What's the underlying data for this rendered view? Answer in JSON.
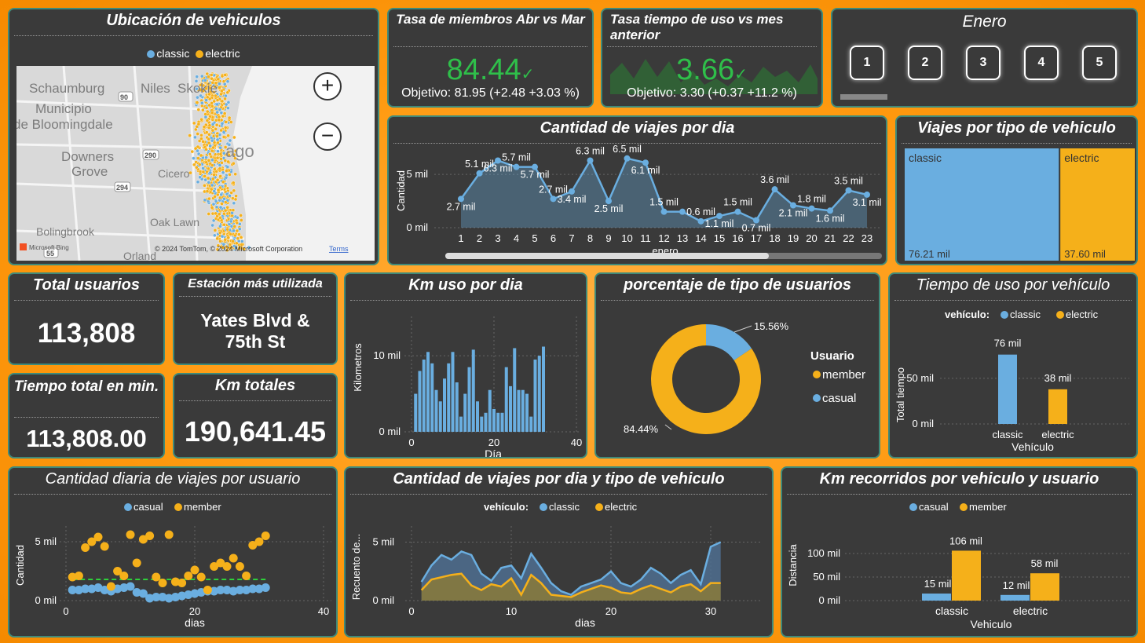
{
  "colors": {
    "classic": "#6aaee0",
    "electric": "#f5b01a",
    "casual": "#6aaee0",
    "member": "#f5b01a",
    "kpi_green": "#2fbf4a",
    "card": "#3a3a3a"
  },
  "map": {
    "title": "Ubicación de vehiculos",
    "legend": [
      "classic",
      "electric"
    ],
    "places": [
      "Schaumburg",
      "Niles",
      "Skokie",
      "Municipio",
      "de Bloomingdale",
      "Downers",
      "Grove",
      "Cicero",
      "Oak Lawn",
      "Bolingbrook",
      "Orland",
      "ago"
    ],
    "roads": [
      "90",
      "290",
      "294",
      "55"
    ],
    "attribution": "© 2024 TomTom, © 2024 Microsoft Corporation",
    "terms": "Terms",
    "bing": "Microsoft Bing",
    "zoom_in": "+",
    "zoom_out": "−"
  },
  "kpi_members": {
    "title": "Tasa de miembros Abr vs Mar",
    "value": "84.44",
    "check": "✓",
    "goal": "Objetivo: 81.95 (+2.48 +3.03 %)"
  },
  "kpi_time": {
    "title": "Tasa tiempo de uso vs mes anterior",
    "value": "3.66",
    "check": "✓",
    "goal": "Objetivo: 3.30 (+0.37 +11.2 %)"
  },
  "month": {
    "title": "Enero",
    "pages": [
      "1",
      "2",
      "3",
      "4",
      "5"
    ]
  },
  "total_users": {
    "title": "Total usuarios",
    "value": "113,808"
  },
  "top_station": {
    "title": "Estación más utilizada",
    "value": "Yates Blvd & 75th St"
  },
  "total_time": {
    "title": "Tiempo total en min.",
    "value": "113,808.00"
  },
  "total_km": {
    "title": "Km totales",
    "value": "190,641.45"
  },
  "chart_data": [
    {
      "id": "trips_per_day",
      "type": "area",
      "title": "Cantidad de viajes por dia",
      "xlabel": "enero",
      "ylabel": "Cantidad",
      "x": [
        1,
        2,
        3,
        4,
        5,
        6,
        7,
        8,
        9,
        10,
        11,
        12,
        13,
        14,
        15,
        16,
        17,
        18,
        19,
        20,
        21,
        22,
        23
      ],
      "values": [
        2.7,
        5.1,
        6.3,
        5.7,
        5.7,
        2.7,
        3.4,
        6.3,
        2.5,
        6.5,
        6.1,
        1.5,
        1.5,
        0.6,
        1.1,
        1.5,
        0.7,
        3.6,
        2.1,
        1.8,
        1.6,
        3.5,
        3.1
      ],
      "labels": [
        "2.7 mil",
        "5.1 mil",
        "6.3 mil",
        "5.7 mil",
        "5.7 mil",
        "2.7 mil",
        "3.4 mil",
        "6.3 mil",
        "2.5 mil",
        "6.5 mil",
        "6.1 mil",
        "1.5 mil",
        "",
        "0.6 mil",
        "1.1 mil",
        "1.5 mil",
        "0.7 mil",
        "3.6 mil",
        "2.1 mil",
        "1.8 mil",
        "1.6 mil",
        "3.5 mil",
        "3.1 mil"
      ],
      "yticks": [
        "0 mil",
        "5 mil"
      ]
    },
    {
      "id": "trips_by_type",
      "type": "treemap",
      "title": "Viajes por tipo de vehiculo",
      "categories": [
        "classic",
        "electric"
      ],
      "values": [
        76.21,
        37.6
      ],
      "value_labels": [
        "76.21 mil",
        "37.60 mil"
      ]
    },
    {
      "id": "km_per_day",
      "type": "bar",
      "title": "Km uso por dia",
      "xlabel": "Día",
      "ylabel": "Kilometros",
      "x": [
        1,
        2,
        3,
        4,
        5,
        6,
        7,
        8,
        9,
        10,
        11,
        12,
        13,
        14,
        15,
        16,
        17,
        18,
        19,
        20,
        21,
        22,
        23,
        24,
        25,
        26,
        27,
        28,
        29,
        30,
        31
      ],
      "values": [
        5,
        8,
        9.5,
        10.5,
        9,
        5.5,
        4,
        7,
        9,
        10.5,
        6.5,
        2,
        5,
        8.5,
        10.8,
        4,
        2,
        2.5,
        5.5,
        3,
        2.5,
        2.5,
        8.5,
        6,
        11,
        5.5,
        5.5,
        5,
        2,
        9.5,
        10,
        11.2
      ],
      "xticks": [
        "0",
        "20",
        "40"
      ],
      "yticks": [
        "0 mil",
        "10 mil"
      ]
    },
    {
      "id": "user_type_pct",
      "type": "pie",
      "title": "porcentaje de tipo de usuarios",
      "legend_title": "Usuario",
      "categories": [
        "member",
        "casual"
      ],
      "values": [
        84.44,
        15.56
      ],
      "labels": [
        "84.44%",
        "15.56%"
      ]
    },
    {
      "id": "time_by_vehicle",
      "type": "bar",
      "title": "Tiempo de uso por vehículo",
      "legend_title": "vehículo:",
      "xlabel": "Vehículo",
      "ylabel": "Total tiempo",
      "categories": [
        "classic",
        "electric"
      ],
      "values": [
        76,
        38
      ],
      "labels": [
        "76 mil",
        "38 mil"
      ],
      "yticks": [
        "0 mil",
        "50 mil"
      ]
    },
    {
      "id": "daily_trips_by_user",
      "type": "scatter",
      "title": "Cantidad diaria de viajes por usuario",
      "xlabel": "dias",
      "ylabel": "Cantidad",
      "series": [
        {
          "name": "casual",
          "x": [
            1,
            2,
            3,
            4,
            5,
            6,
            7,
            8,
            9,
            10,
            11,
            12,
            13,
            14,
            15,
            16,
            17,
            18,
            19,
            20,
            21,
            22,
            23,
            24,
            25,
            26,
            27,
            28,
            29,
            30,
            31
          ],
          "values": [
            0.9,
            0.9,
            1.0,
            1.0,
            1.1,
            0.9,
            0.8,
            1.0,
            1.1,
            1.2,
            0.7,
            0.6,
            0.2,
            0.3,
            0.3,
            0.2,
            0.3,
            0.4,
            0.5,
            0.6,
            0.7,
            0.8,
            0.8,
            0.9,
            0.9,
            0.8,
            0.9,
            0.9,
            1.0,
            1.0,
            1.1
          ]
        },
        {
          "name": "member",
          "x": [
            1,
            2,
            3,
            4,
            5,
            6,
            7,
            8,
            9,
            10,
            11,
            12,
            13,
            14,
            15,
            16,
            17,
            18,
            19,
            20,
            21,
            22,
            23,
            24,
            25,
            26,
            27,
            28,
            29,
            30,
            31
          ],
          "values": [
            2.0,
            2.1,
            4.5,
            5.0,
            5.4,
            4.6,
            1.2,
            2.5,
            2.1,
            5.6,
            3.2,
            5.2,
            5.5,
            2.0,
            1.5,
            5.6,
            1.6,
            1.5,
            2.1,
            2.6,
            2.0,
            0.9,
            2.9,
            3.2,
            2.9,
            3.6,
            2.9,
            2.1,
            4.7,
            5.0,
            5.5
          ]
        }
      ],
      "avg_line": 1.8,
      "xticks": [
        "0",
        "20",
        "40"
      ],
      "yticks": [
        "0 mil",
        "5 mil"
      ]
    },
    {
      "id": "trips_by_day_type",
      "type": "area",
      "title": "Cantidad de viajes por dia y tipo de vehiculo",
      "legend_title": "vehículo:",
      "xlabel": "dias",
      "ylabel": "Recuento de...",
      "x": [
        1,
        2,
        3,
        4,
        5,
        6,
        7,
        8,
        9,
        10,
        11,
        12,
        13,
        14,
        15,
        16,
        17,
        18,
        19,
        20,
        21,
        22,
        23,
        24,
        25,
        26,
        27,
        28,
        29,
        30,
        31
      ],
      "series": [
        {
          "name": "classic",
          "values": [
            1.6,
            3.0,
            3.9,
            3.5,
            4.2,
            3.9,
            2.3,
            1.7,
            2.8,
            3.0,
            1.9,
            4.0,
            2.8,
            1.5,
            0.8,
            0.5,
            1.2,
            1.5,
            1.8,
            2.5,
            1.5,
            1.2,
            1.8,
            2.8,
            2.3,
            1.5,
            2.2,
            2.6,
            1.4,
            4.6,
            5.0
          ]
        },
        {
          "name": "electric",
          "values": [
            0.9,
            1.8,
            2.0,
            2.2,
            2.3,
            1.3,
            0.9,
            1.4,
            1.2,
            1.9,
            0.5,
            2.2,
            1.5,
            0.5,
            0.4,
            0.3,
            0.7,
            1.0,
            1.3,
            1.1,
            0.7,
            0.6,
            1.0,
            1.3,
            1.0,
            0.7,
            1.2,
            1.4,
            0.8,
            1.5,
            1.5
          ]
        }
      ],
      "xticks": [
        "0",
        "10",
        "20",
        "30"
      ],
      "yticks": [
        "0 mil",
        "5 mil"
      ]
    },
    {
      "id": "km_by_vehicle_user",
      "type": "bar",
      "title": "Km recorridos por vehiculo y usuario",
      "xlabel": "Vehiculo",
      "ylabel": "Distancia",
      "categories": [
        "classic",
        "electric"
      ],
      "series": [
        {
          "name": "casual",
          "values": [
            15,
            12
          ],
          "labels": [
            "15 mil",
            "12 mil"
          ]
        },
        {
          "name": "member",
          "values": [
            106,
            58
          ],
          "labels": [
            "106 mil",
            "58 mil"
          ]
        }
      ],
      "yticks": [
        "0 mil",
        "50 mil",
        "100 mil"
      ]
    }
  ]
}
